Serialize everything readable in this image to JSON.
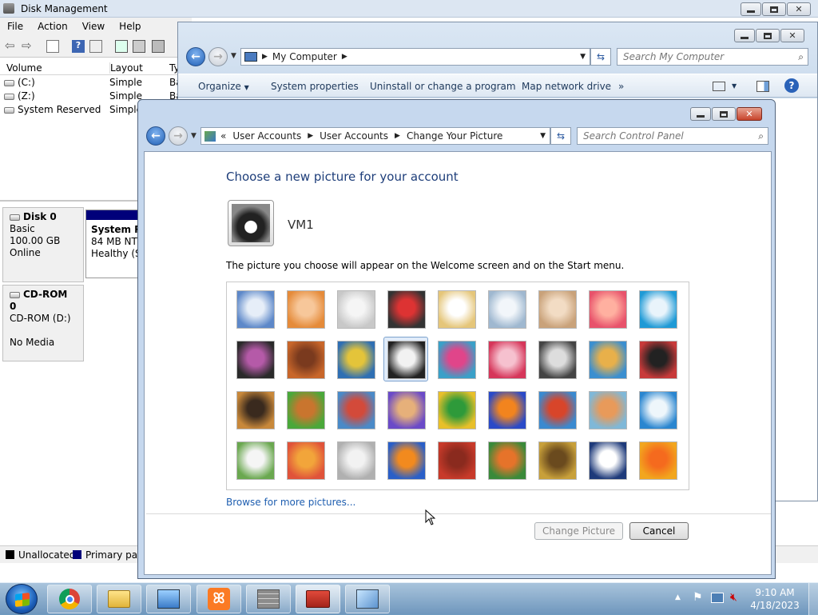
{
  "disk_management": {
    "title": "Disk Management",
    "menu": [
      "File",
      "Action",
      "View",
      "Help"
    ],
    "columns": {
      "volume": "Volume",
      "layout": "Layout",
      "type": "Ty"
    },
    "volumes": [
      {
        "name": "(C:)",
        "layout": "Simple",
        "type": "Ba"
      },
      {
        "name": "(Z:)",
        "layout": "Simple",
        "type": "Ba"
      },
      {
        "name": "System Reserved",
        "layout": "Simple",
        "type": "Ba"
      }
    ],
    "disk0": {
      "name": "Disk 0",
      "type": "Basic",
      "size": "100.00 GB",
      "status": "Online",
      "partition_name": "System Re",
      "partition_size": "84 MB NTF",
      "partition_status": "Healthy (Sy"
    },
    "cdrom": {
      "name": "CD-ROM 0",
      "type": "CD-ROM (D:)",
      "status": "No Media"
    },
    "legend": {
      "unallocated": "Unallocated",
      "primary": "Primary part"
    }
  },
  "my_computer": {
    "address": "My Computer",
    "search_placeholder": "Search My Computer",
    "commands": [
      "Organize",
      "System properties",
      "Uninstall or change a program",
      "Map network drive",
      "»"
    ]
  },
  "change_picture": {
    "breadcrumb": [
      "User Accounts",
      "User Accounts",
      "Change Your Picture"
    ],
    "search_placeholder": "Search Control Panel",
    "heading": "Choose a new picture for your account",
    "username": "VM1",
    "description": "The picture you choose will appear on the Welcome screen and on the Start menu.",
    "browse_link": "Browse for more pictures...",
    "change_button": "Change Picture",
    "cancel_button": "Cancel",
    "pictures": [
      "roller-coaster",
      "starfish",
      "robot-figure",
      "turntable",
      "lucky-cat",
      "gyroscope",
      "kitten",
      "flower",
      "pinwheel",
      "ball",
      "fabric",
      "leaf",
      "dog",
      "crayons",
      "star-ornament",
      "jacks",
      "stairs",
      "paper-crane",
      "guitar",
      "puppy",
      "toy-robot",
      "scarf",
      "sunflower",
      "fish",
      "balloon",
      "doll",
      "sailboat",
      "soccer-ball",
      "textile",
      "marbles",
      "window",
      "rug",
      "butterfly",
      "pattern",
      "lighthouse",
      "daisy"
    ],
    "selected_index": 12
  },
  "taskbar": {
    "time": "9:10 AM",
    "date": "4/18/2023",
    "apps": [
      "chrome-icon",
      "explorer-icon",
      "control-panel-icon",
      "xampp-icon",
      "firewall-icon",
      "toolbox-icon",
      "network-icon"
    ]
  }
}
